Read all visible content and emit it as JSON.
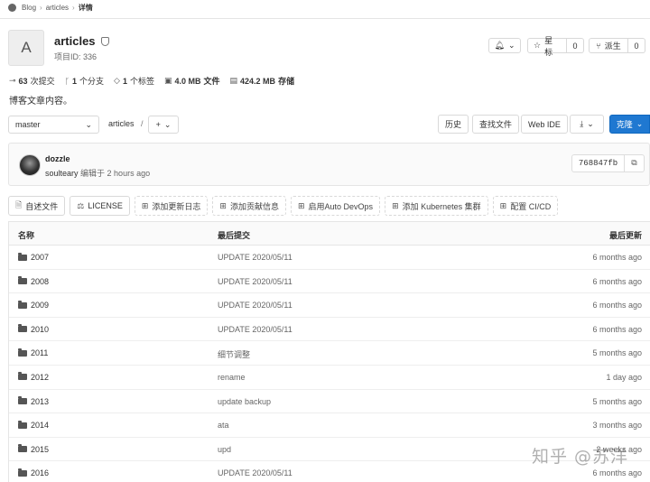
{
  "breadcrumb": {
    "items": [
      "Blog",
      "articles",
      "详情"
    ]
  },
  "project": {
    "avatar_letter": "A",
    "name": "articles",
    "id_label": "项目ID: 336"
  },
  "actions": {
    "notify_icon": "bell-icon",
    "star_label": "星标",
    "star_count": "0",
    "fork_label": "派生",
    "fork_count": "0"
  },
  "stats": {
    "commits": "63",
    "commits_label": "次提交",
    "branches": "1",
    "branches_label": "个分支",
    "tags": "1",
    "tags_label": "个标签",
    "files_size": "4.0 MB",
    "files_label": "文件",
    "storage_size": "424.2 MB",
    "storage_label": "存储"
  },
  "description": "博客文章内容。",
  "toolbar": {
    "branch": "master",
    "path": "articles",
    "path_sep": "/",
    "plus": "+",
    "history": "历史",
    "find_file": "查找文件",
    "web_ide": "Web IDE",
    "clone": "克隆"
  },
  "commit": {
    "message": "dozzle",
    "author": "soulteary",
    "action": "编辑于 2 hours ago",
    "sha": "768847fb"
  },
  "quick_links": [
    {
      "label": "自述文件",
      "icon": "file-icon"
    },
    {
      "label": "LICENSE",
      "icon": "scale-icon"
    },
    {
      "label": "添加更新日志",
      "icon": "plus-square-icon"
    },
    {
      "label": "添加贡献信息",
      "icon": "plus-square-icon"
    },
    {
      "label": "启用Auto DevOps",
      "icon": "plus-square-icon"
    },
    {
      "label": "添加 Kubernetes 集群",
      "icon": "plus-square-icon"
    },
    {
      "label": "配置 CI/CD",
      "icon": "plus-square-icon"
    }
  ],
  "table": {
    "headers": {
      "name": "名称",
      "last_commit": "最后提交",
      "last_update": "最后更新"
    },
    "rows": [
      {
        "name": "2007",
        "commit": "UPDATE 2020/05/11",
        "time": "6 months ago"
      },
      {
        "name": "2008",
        "commit": "UPDATE 2020/05/11",
        "time": "6 months ago"
      },
      {
        "name": "2009",
        "commit": "UPDATE 2020/05/11",
        "time": "6 months ago"
      },
      {
        "name": "2010",
        "commit": "UPDATE 2020/05/11",
        "time": "6 months ago"
      },
      {
        "name": "2011",
        "commit": "细节调整",
        "time": "5 months ago"
      },
      {
        "name": "2012",
        "commit": "rename",
        "time": "1 day ago"
      },
      {
        "name": "2013",
        "commit": "update backup",
        "time": "5 months ago"
      },
      {
        "name": "2014",
        "commit": "ata",
        "time": "3 months ago"
      },
      {
        "name": "2015",
        "commit": "upd",
        "time": "2 weeks ago"
      },
      {
        "name": "2016",
        "commit": "UPDATE 2020/05/11",
        "time": "6 months ago"
      }
    ]
  },
  "watermark": "知乎 @苏洋"
}
